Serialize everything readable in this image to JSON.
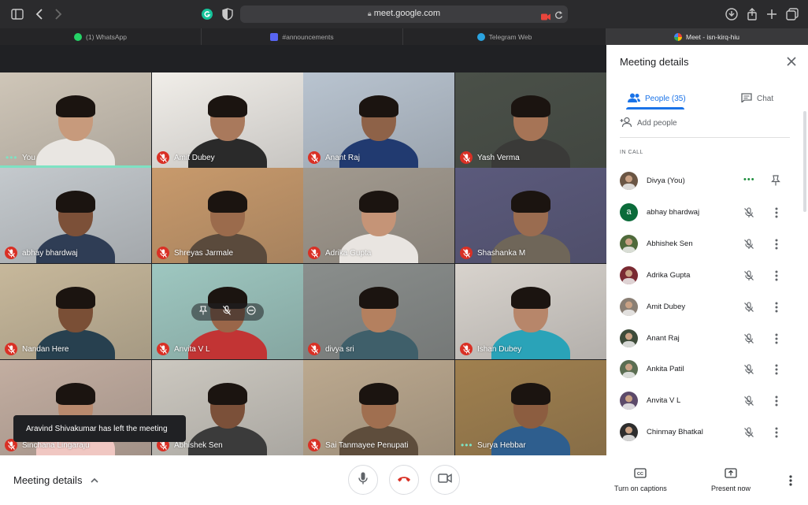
{
  "browser": {
    "url": "meet.google.com",
    "tabs": [
      {
        "label": "(1) WhatsApp",
        "icon": "whatsapp-icon",
        "active": false
      },
      {
        "label": "#announcements",
        "icon": "discord-icon",
        "active": false
      },
      {
        "label": "Telegram Web",
        "icon": "telegram-icon",
        "active": false
      },
      {
        "label": "Meet - isn-kirq-hiu",
        "icon": "meet-icon",
        "active": true
      }
    ]
  },
  "tiles": [
    {
      "name": "You",
      "state": "speaking",
      "bg": "#cfc6b8",
      "skin": "#c79a7c",
      "shirt": "#e9e6e2"
    },
    {
      "name": "Amit Dubey",
      "state": "muted",
      "bg": "#f1eee9",
      "skin": "#a9795c",
      "shirt": "#2a2a2a"
    },
    {
      "name": "Anant Raj",
      "state": "muted",
      "bg": "#b9c4d0",
      "skin": "#8e6248",
      "shirt": "#213a70"
    },
    {
      "name": "Yash Verma",
      "state": "muted",
      "bg": "#4a5048",
      "skin": "#a67456",
      "shirt": "#3a3a38"
    },
    {
      "name": "abhay bhardwaj",
      "state": "muted",
      "bg": "#c4c9cd",
      "skin": "#7c5038",
      "shirt": "#2f3d55"
    },
    {
      "name": "Shreyas Jarmale",
      "state": "muted",
      "bg": "#c89a6c",
      "skin": "#9b6b4c",
      "shirt": "#5a4a3c"
    },
    {
      "name": "Adrika Gupta",
      "state": "muted",
      "bg": "#a29a8f",
      "skin": "#c59477",
      "shirt": "#e9e5e1"
    },
    {
      "name": "Shashanka M",
      "state": "muted",
      "bg": "#5b5a7c",
      "skin": "#9a6c50",
      "shirt": "#6f6659"
    },
    {
      "name": "Nandan Here",
      "state": "muted",
      "bg": "#c7b89b",
      "skin": "#7a4f36",
      "shirt": "#27404f"
    },
    {
      "name": "Anvita V L",
      "state": "muted",
      "bg": "#9ec7c0",
      "skin": "#9a6649",
      "shirt": "#c23434"
    },
    {
      "name": "divya sri",
      "state": "muted",
      "bg": "#8a8e8c",
      "skin": "#b4805f",
      "shirt": "#3f5f6a"
    },
    {
      "name": "Ishan Dubey",
      "state": "muted",
      "bg": "#d8d3cd",
      "skin": "#b7866a",
      "shirt": "#2aa3b8"
    },
    {
      "name": "Sinchana Lingaraju",
      "state": "muted",
      "bg": "#c3aea1",
      "skin": "#b98a6e",
      "shirt": "#f0c7c2"
    },
    {
      "name": "Abhishek Sen",
      "state": "muted",
      "bg": "#ccc8c0",
      "skin": "#7b5039",
      "shirt": "#3b3b3b"
    },
    {
      "name": "Sai Tanmayee Penupati",
      "state": "muted",
      "bg": "#bca98f",
      "skin": "#a06f50",
      "shirt": "#5e4d3c"
    },
    {
      "name": "Surya Hebbar",
      "state": "speaking",
      "bg": "#a0804f",
      "skin": "#8c5d40",
      "shirt": "#2e5e8e"
    }
  ],
  "toast": "Aravind Shivakumar has left the meeting",
  "panel": {
    "title": "Meeting details",
    "tab_people": "People (35)",
    "tab_chat": "Chat",
    "add_people": "Add people",
    "section": "IN CALL",
    "participants": [
      {
        "name": "Divya (You)",
        "avatar": "photo",
        "color": "#6b5644",
        "letter": ""
      },
      {
        "name": "abhay bhardwaj",
        "avatar": "letter",
        "color": "#0b6b3a",
        "letter": "a"
      },
      {
        "name": "Abhishek Sen",
        "avatar": "photo",
        "color": "#4f6a3b",
        "letter": ""
      },
      {
        "name": "Adrika Gupta",
        "avatar": "photo",
        "color": "#7a2a32",
        "letter": ""
      },
      {
        "name": "Amit Dubey",
        "avatar": "photo",
        "color": "#8a7f74",
        "letter": ""
      },
      {
        "name": "Anant Raj",
        "avatar": "photo",
        "color": "#3e4c3a",
        "letter": ""
      },
      {
        "name": "Ankita Patil",
        "avatar": "photo",
        "color": "#5b6e52",
        "letter": ""
      },
      {
        "name": "Anvita V L",
        "avatar": "photo",
        "color": "#5c4a6a",
        "letter": ""
      },
      {
        "name": "Chinmay Bhatkal",
        "avatar": "photo",
        "color": "#2e2e2e",
        "letter": ""
      }
    ]
  },
  "bottom": {
    "details_label": "Meeting details",
    "captions_label": "Turn on captions",
    "present_label": "Present now"
  },
  "colors": {
    "muted_red": "#d93025",
    "speaking_teal": "#7ee2c3",
    "accent_blue": "#1a73e8"
  }
}
